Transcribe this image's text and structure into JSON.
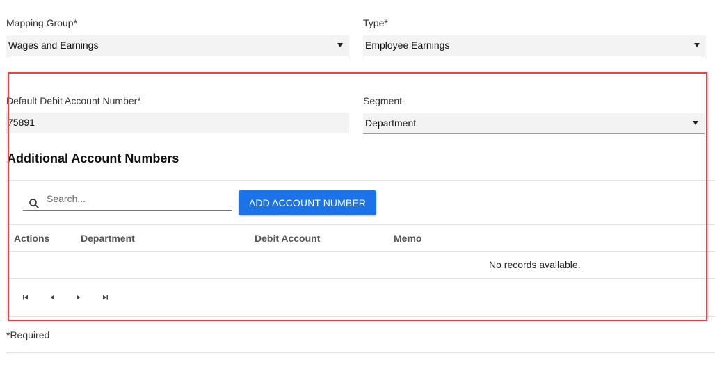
{
  "mapping_group": {
    "label": "Mapping Group*",
    "value": "Wages and Earnings"
  },
  "type": {
    "label": "Type*",
    "value": "Employee Earnings"
  },
  "default_debit": {
    "label": "Default Debit Account Number*",
    "value": "75891"
  },
  "segment": {
    "label": "Segment",
    "value": "Department"
  },
  "additional": {
    "title": "Additional Account Numbers",
    "search_placeholder": "Search...",
    "add_button": "ADD ACCOUNT NUMBER",
    "columns": [
      "Actions",
      "Department",
      "Debit Account",
      "Memo"
    ],
    "empty_text": "No records available."
  },
  "footer": {
    "required_note": "*Required"
  },
  "icons": {
    "search": "search-icon",
    "dropdown": "chevron-down-icon",
    "first": "first-page-icon",
    "prev": "previous-page-icon",
    "next": "next-page-icon",
    "last": "last-page-icon"
  },
  "colors": {
    "primary_button": "#1a73e8",
    "highlight_border": "#e8424a"
  }
}
